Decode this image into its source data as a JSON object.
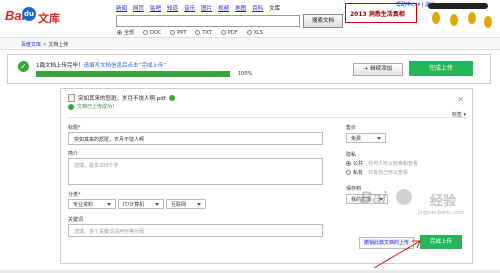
{
  "header": {
    "logo_left": "Bai",
    "logo_paw": "du",
    "logo_right": "文库",
    "nav": [
      "新闻",
      "网页",
      "贴吧",
      "知道",
      "音乐",
      "图片",
      "视频",
      "地图",
      "百科",
      "文库"
    ],
    "nav_active_index": 9,
    "search_value": "",
    "search_button": "搜索文档",
    "filters": [
      {
        "label": "全部",
        "checked": true
      },
      {
        "label": "DOC",
        "checked": false
      },
      {
        "label": "PPT",
        "checked": false
      },
      {
        "label": "TXT",
        "checked": false
      },
      {
        "label": "PDF",
        "checked": false
      },
      {
        "label": "XLS",
        "checked": false
      }
    ],
    "user_links": "帮助中心 ▾ | 退出",
    "banner_text": "2013 洞悉生活真相"
  },
  "breadcrumb": {
    "root": "百度文库",
    "sep": " > ",
    "current": "文档上传"
  },
  "status": {
    "message_prefix": "1篇文档上传完毕！",
    "message_highlight": "请填写文档信息后点击“完成上传”",
    "progress_percent": 100,
    "progress_label": "100%",
    "add_button": "+ 继续添加",
    "done_button": "完成上传"
  },
  "doc": {
    "filename": "突如其来的怒斑，岁月不饶人啊.pdf",
    "uploaded_text": "文档已上传成功！",
    "tag_link": "标签 ▾",
    "title_label": "标题",
    "title_value": "突如其来的怒斑，岁月不饶人啊",
    "intro_label": "简介",
    "intro_placeholder": "选填，最多200个字",
    "category_label": "分类",
    "category_values": [
      "专业资料",
      "IT/计算机",
      "互联网"
    ],
    "keywords_label": "关键词",
    "keywords_placeholder": "选填，多个关键词请用空格分隔",
    "price_label": "售价",
    "price_value": "免费",
    "privacy_label": "隐私",
    "privacy_options": [
      {
        "label": "公共",
        "hint": "任何人可以检索和查看",
        "checked": true
      },
      {
        "label": "私有",
        "hint": "只有自己可以查看",
        "checked": false
      }
    ],
    "save_to_label": "保存到",
    "save_to_value": "我的文库",
    "cancel_link": "撤销此篇文档的上传",
    "confirm_button": "完成上传"
  },
  "watermark": {
    "brand": "Bai",
    "brand2": "经验",
    "url": "jingyan.baidu.com"
  }
}
